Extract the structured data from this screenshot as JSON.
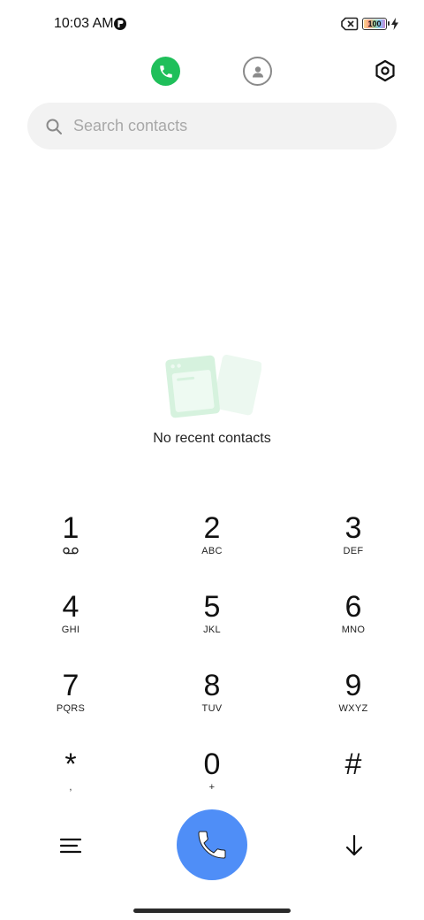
{
  "status_bar": {
    "time": "10:03 AM",
    "battery_level": "100",
    "battery_fraction": 1.0,
    "icons": [
      "app-notification-icon",
      "no-sim-icon",
      "battery-icon",
      "charging-bolt-icon"
    ]
  },
  "tabs": {
    "active": "calls",
    "items": [
      {
        "id": "calls",
        "icon": "phone-icon",
        "color": "#1fbf5a"
      },
      {
        "id": "contacts",
        "icon": "person-icon",
        "color": "#8a8a8a"
      }
    ],
    "settings_icon": "gear-icon"
  },
  "search": {
    "placeholder": "Search contacts",
    "value": ""
  },
  "empty_state": {
    "icon": "recent-cards-illustration",
    "message": "No recent contacts",
    "color": "#d6f2de"
  },
  "dialpad": {
    "keys": [
      {
        "digit": "1",
        "letters": "",
        "icon": "voicemail-icon"
      },
      {
        "digit": "2",
        "letters": "ABC"
      },
      {
        "digit": "3",
        "letters": "DEF"
      },
      {
        "digit": "4",
        "letters": "GHI"
      },
      {
        "digit": "5",
        "letters": "JKL"
      },
      {
        "digit": "6",
        "letters": "MNO"
      },
      {
        "digit": "7",
        "letters": "PQRS"
      },
      {
        "digit": "8",
        "letters": "TUV"
      },
      {
        "digit": "9",
        "letters": "WXYZ"
      },
      {
        "digit": "*",
        "letters": ","
      },
      {
        "digit": "0",
        "letters": "+"
      },
      {
        "digit": "#",
        "letters": ""
      }
    ]
  },
  "bottom_bar": {
    "menu_icon": "menu-icon",
    "call_icon": "phone-icon",
    "call_color": "#4f8ef7",
    "collapse_icon": "arrow-down-icon"
  }
}
